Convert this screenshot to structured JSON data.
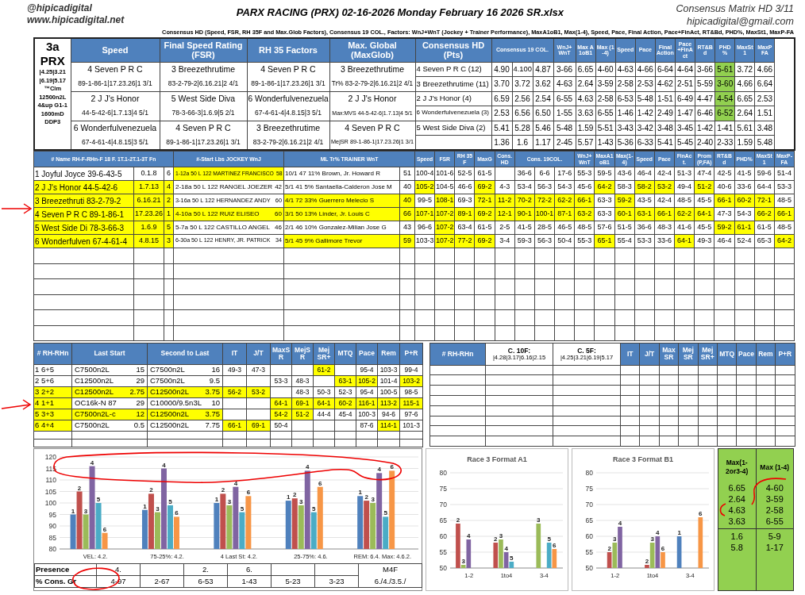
{
  "header": {
    "handle": "@hipicadigital",
    "website": "www.hipicadigital.net",
    "title": "PARX RACING (PRX) 02-16-2026 Monday February 16 2026 SR.xlsx",
    "matrix": "Consensus Matrix HD 3/11",
    "email": "hipicadigital@gmail.com",
    "subtitle": "Consensus HD (Speed, FSR, RH 35F and Max.Glob Factors), Consensus 19 COL., Factors: WnJ+WnT (Jockey + Trainer Performance), MaxA1oB1, Max(1-4), Speed, Pace, Final Action, Pace+FinAct, RT&Bd, PHD%, MaxSt1, MaxP-FA"
  },
  "race_info": [
    "3a",
    "PRX",
    "|4.25|3.21",
    "|6.19|5.17",
    "™Clm",
    "12500n2L",
    "4&up G1-1",
    "1600mD",
    "DDP3"
  ],
  "factor_columns": [
    {
      "title": "Speed",
      "picks": [
        {
          "horse": "4 Seven P R C",
          "line": "89-1-86-1|17.23.26|1  3/1"
        },
        {
          "horse": "2 J J's Honor",
          "line": "44-5-42-6|1.7.13|4  5/1"
        },
        {
          "horse": "6 Wonderfulvenezuela",
          "line": "67-4-61-4|4.8.15|3  5/1"
        }
      ]
    },
    {
      "title": "Final Speed Rating (FSR)",
      "picks": [
        {
          "horse": "3 Breezethrutime",
          "line": "83-2-79-2|6.16.21|2  4/1"
        },
        {
          "horse": "5 West Side Diva",
          "line": "78-3-66-3|1.6.9|5  2/1"
        },
        {
          "horse": "4 Seven P R C",
          "line": "89-1-86-1|17.23.26|1  3/1"
        }
      ]
    },
    {
      "title": "RH 35 Factors",
      "picks": [
        {
          "horse": "4 Seven P R C",
          "line": "89-1-86-1|17.23.26|1  3/1"
        },
        {
          "horse": "6 Wonderfulvenezuela",
          "line": "67-4-61-4|4.8.15|3  5/1"
        },
        {
          "horse": "3 Breezethrutime",
          "line": "83-2-79-2|6.16.21|2  4/1"
        }
      ]
    },
    {
      "title": "Max. Global (MaxGlob)",
      "picks": [
        {
          "horse": "3 Breezethrutime",
          "line": "Tr% 83-2-79-2|6.16.21|2  4/1"
        },
        {
          "horse": "2 J J's Honor",
          "line": "Max:MVS 44-5-42-6|1.7.13|4  5/1"
        },
        {
          "horse": "4 Seven P R C",
          "line": "MejSR 89-1-86-1|17.23.26|1  3/1"
        }
      ]
    }
  ],
  "consensus_hd": {
    "title": "Consensus HD (Pts)",
    "picks": [
      "4 Seven P R C  (12)",
      "3 Breezethrutime  (11)",
      "2 J J's Honor  (4)",
      "6 Wonderfulvenezuela  (3)",
      "5 West Side Diva  (2)"
    ]
  },
  "consensus19_header": "Consensus 19 COL.",
  "stat_headers": [
    "WnJ+ WnT",
    "Max A1oB1",
    "Max (1-4)",
    "Speed",
    "Pace",
    "Final Action",
    "Pace +FinAct",
    "RT&Bd",
    "PHD %",
    "MaxSt1",
    "MaxP FA"
  ],
  "stat_rows": [
    {
      "values": [
        "4.90",
        "4.100",
        "4.87",
        "3-66",
        "6.65",
        "4-60",
        "4-63",
        "4-66",
        "6-64",
        "4-64",
        "3-66",
        "5-61",
        "3.72",
        "4.66"
      ],
      "phd_highlighted": true
    },
    {
      "values": [
        "3.70",
        "3.72",
        "3.62",
        "4-63",
        "2.64",
        "3-59",
        "2-58",
        "2-53",
        "4-62",
        "2-51",
        "5-59",
        "3-60",
        "4.66",
        "6.64"
      ],
      "phd_highlighted": true
    },
    {
      "values": [
        "6.59",
        "2.56",
        "2.54",
        "6-55",
        "4.63",
        "2-58",
        "6-53",
        "5-48",
        "1-51",
        "6-49",
        "4-47",
        "4-54",
        "6.65",
        "2.53"
      ],
      "phd_highlighted": true
    },
    {
      "values": [
        "2.53",
        "6.56",
        "6.50",
        "1-55",
        "3.63",
        "6-55",
        "1-46",
        "1-42",
        "2-49",
        "1-47",
        "6-46",
        "6-52",
        "2.64",
        "1.51"
      ],
      "phd_highlighted": true
    },
    {
      "values": [
        "5.41",
        "5.28",
        "5.46",
        "5-48",
        "1.59",
        "5-51",
        "3-43",
        "3-42",
        "3-48",
        "3-45",
        "1-42",
        "1-41",
        "5.61",
        "3.48"
      ],
      "phd_highlighted": false
    },
    {
      "values": [
        "1.36",
        "1.6",
        "1.17",
        "2-45",
        "5.57",
        "1-43",
        "5-36",
        "6-33",
        "5-41",
        "5-45",
        "2-40",
        "2-33",
        "1.59",
        "5.48"
      ],
      "phd_highlighted": false
    }
  ],
  "entries": {
    "columns": [
      "# Name  RH-F-RHn-F 18 F. 1T.1-2T.1-3T Fn",
      "#-Start  Lbs  JOCKEY  WnJ",
      "ML  Tr%  TRAINER  WnT"
    ],
    "stat_headers": [
      {
        "label": "Speed",
        "kind": "single"
      },
      {
        "label": "FSR",
        "kind": "single"
      },
      {
        "label": "RH 35F",
        "kind": "single"
      },
      {
        "label": "MaxG",
        "kind": "single"
      },
      {
        "label": "Cons.HD",
        "kind": "single"
      },
      {
        "label": "Cons. 19COL.",
        "kind": "triple"
      },
      {
        "label": "WnJ+WnT",
        "kind": "single"
      },
      {
        "label": "MaxA1oB1",
        "kind": "single"
      },
      {
        "label": "Max(1-4)",
        "kind": "single"
      },
      {
        "label": "Speed",
        "kind": "single"
      },
      {
        "label": "Pace",
        "kind": "single"
      },
      {
        "label": "FinAct.",
        "kind": "single"
      },
      {
        "label": "Prom(P,FA)",
        "kind": "single"
      },
      {
        "label": "RT&Bd",
        "kind": "single"
      },
      {
        "label": "PHD%",
        "kind": "single"
      },
      {
        "label": "MaxSt1",
        "kind": "single"
      },
      {
        "label": "MaxP-FA",
        "kind": "single"
      }
    ],
    "rows": [
      {
        "name": "1 Joyful Joyce 39-6-43-5",
        "finishes": "0.1.8",
        "fn": "6",
        "name_highlighted": false,
        "jockey": "1-12a 50 L 122 MARTINEZ FRANCISCO",
        "wnj": "58",
        "jockey_highlighted": true,
        "trainer": "10/1  47 11%  Brown, Jr. Howard R",
        "wnt": "51",
        "trainer_highlighted": false,
        "cells": [
          {
            "value": "100-4",
            "highlighted": false
          },
          {
            "value": "101-6",
            "highlighted": false
          },
          {
            "value": "52-5",
            "highlighted": false
          },
          {
            "value": "61-5",
            "highlighted": false
          },
          {
            "highlighted": false
          },
          {
            "value": "36-6",
            "highlighted": false
          },
          {
            "value": "6-6",
            "highlighted": false
          },
          {
            "value": "17-6",
            "highlighted": false
          },
          {
            "value": "55-3",
            "highlighted": false
          },
          {
            "value": "59-5",
            "highlighted": false
          },
          {
            "value": "43-6",
            "highlighted": false
          },
          {
            "value": "46-4",
            "highlighted": false
          },
          {
            "value": "42-4",
            "highlighted": false
          },
          {
            "value": "51-3",
            "highlighted": false
          },
          {
            "value": "47-4",
            "highlighted": false
          },
          {
            "value": "42-5",
            "highlighted": false
          },
          {
            "value": "41-5",
            "highlighted": false
          },
          {
            "value": "59-6",
            "highlighted": false
          },
          {
            "value": "51-4",
            "highlighted": false
          }
        ]
      },
      {
        "name": "2 J J's Honor  44-5-42-6",
        "finishes": "1.7.13",
        "fn": "4",
        "name_highlighted": true,
        "jockey": "2-18a 50 L 122 RANGEL JOEZER",
        "wnj": "42",
        "jockey_highlighted": false,
        "trainer": "5/1  41  5%  Santaella-Calderon Jose M",
        "wnt": "40",
        "trainer_highlighted": false,
        "cells": [
          {
            "value": "105-2",
            "highlighted": true
          },
          {
            "value": "104-5",
            "highlighted": false
          },
          {
            "value": "46-6",
            "highlighted": false
          },
          {
            "value": "69-2",
            "highlighted": true
          },
          {
            "value": "4-3",
            "highlighted": false
          },
          {
            "value": "53-4",
            "highlighted": false
          },
          {
            "value": "56-3",
            "highlighted": false
          },
          {
            "value": "54-3",
            "highlighted": false
          },
          {
            "value": "45-6",
            "highlighted": false
          },
          {
            "value": "64-2",
            "highlighted": true
          },
          {
            "value": "58-3",
            "highlighted": false
          },
          {
            "value": "58-2",
            "highlighted": true
          },
          {
            "value": "53-2",
            "highlighted": true
          },
          {
            "value": "49-4",
            "highlighted": false
          },
          {
            "value": "51-2",
            "highlighted": true
          },
          {
            "value": "40-6",
            "highlighted": false
          },
          {
            "value": "33-6",
            "highlighted": false
          },
          {
            "value": "64-4",
            "highlighted": false
          },
          {
            "value": "53-3",
            "highlighted": false
          }
        ]
      },
      {
        "name": "3 Breezethruti 83-2-79-2",
        "finishes": "6.16.21",
        "fn": "2",
        "name_highlighted": true,
        "jockey": "3-16a 50 L 122 HERNANDEZ ANDY",
        "wnj": "60",
        "jockey_highlighted": false,
        "trainer": "4/1  72 33%  Guerrero Melecio S",
        "wnt": "40",
        "trainer_highlighted": true,
        "cells": [
          {
            "value": "99-5",
            "highlighted": false
          },
          {
            "value": "108-1",
            "highlighted": true
          },
          {
            "value": "69-3",
            "highlighted": false
          },
          {
            "value": "72-1",
            "highlighted": true
          },
          {
            "value": "11-2",
            "highlighted": true
          },
          {
            "value": "70-2",
            "highlighted": true
          },
          {
            "value": "72-2",
            "highlighted": true
          },
          {
            "value": "62-2",
            "highlighted": true
          },
          {
            "value": "66-1",
            "highlighted": true
          },
          {
            "value": "63-3",
            "highlighted": false
          },
          {
            "value": "59-2",
            "highlighted": true
          },
          {
            "value": "43-5",
            "highlighted": false
          },
          {
            "value": "42-4",
            "highlighted": false
          },
          {
            "value": "48-5",
            "highlighted": false
          },
          {
            "value": "45-5",
            "highlighted": false
          },
          {
            "value": "66-1",
            "highlighted": true
          },
          {
            "value": "60-2",
            "highlighted": true
          },
          {
            "value": "72-1",
            "highlighted": true
          },
          {
            "value": "48-5",
            "highlighted": false
          }
        ]
      },
      {
        "name": "4 Seven P R C  89-1-86-1",
        "finishes": "17.23.26",
        "fn": "1",
        "name_highlighted": true,
        "jockey": "4-10a 50 L 122 RUIZ ELISEO",
        "wnj": "60",
        "jockey_highlighted": true,
        "trainer": "3/1  50 13%  Linder, Jr. Louis C",
        "wnt": "66",
        "trainer_highlighted": true,
        "cells": [
          {
            "value": "107-1",
            "highlighted": true
          },
          {
            "value": "107-2",
            "highlighted": true
          },
          {
            "value": "89-1",
            "highlighted": true
          },
          {
            "value": "69-2",
            "highlighted": true
          },
          {
            "value": "12-1",
            "highlighted": true
          },
          {
            "value": "90-1",
            "highlighted": true
          },
          {
            "value": "100-1",
            "highlighted": true
          },
          {
            "value": "87-1",
            "highlighted": true
          },
          {
            "value": "63-2",
            "highlighted": true
          },
          {
            "value": "63-3",
            "highlighted": false
          },
          {
            "value": "60-1",
            "highlighted": true
          },
          {
            "value": "63-1",
            "highlighted": true
          },
          {
            "value": "66-1",
            "highlighted": true
          },
          {
            "value": "62-2",
            "highlighted": true
          },
          {
            "value": "64-1",
            "highlighted": true
          },
          {
            "value": "47-3",
            "highlighted": false
          },
          {
            "value": "54-3",
            "highlighted": false
          },
          {
            "value": "66-2",
            "highlighted": true
          },
          {
            "value": "66-1",
            "highlighted": true
          }
        ]
      },
      {
        "name": "5 West Side Di 78-3-66-3",
        "finishes": "1.6.9",
        "fn": "5",
        "name_highlighted": true,
        "jockey": "5-7a 50 L 122 CASTILLO ANGEL",
        "wnj": "46",
        "jockey_highlighted": false,
        "trainer": "2/1  46 10%  Gonzalez-Milian Jose G",
        "wnt": "43",
        "trainer_highlighted": false,
        "cells": [
          {
            "value": "96-6",
            "highlighted": false
          },
          {
            "value": "107-2",
            "highlighted": true
          },
          {
            "value": "63-4",
            "highlighted": false
          },
          {
            "value": "61-5",
            "highlighted": false
          },
          {
            "value": "2-5",
            "highlighted": false
          },
          {
            "value": "41-5",
            "highlighted": false
          },
          {
            "value": "28-5",
            "highlighted": false
          },
          {
            "value": "46-5",
            "highlighted": false
          },
          {
            "value": "48-5",
            "highlighted": false
          },
          {
            "value": "57-6",
            "highlighted": false
          },
          {
            "value": "51-5",
            "highlighted": false
          },
          {
            "value": "36-6",
            "highlighted": false
          },
          {
            "value": "48-3",
            "highlighted": false
          },
          {
            "value": "41-6",
            "highlighted": false
          },
          {
            "value": "45-5",
            "highlighted": false
          },
          {
            "value": "59-2",
            "highlighted": true
          },
          {
            "value": "61-1",
            "highlighted": true
          },
          {
            "value": "61-5",
            "highlighted": false
          },
          {
            "value": "48-5",
            "highlighted": false
          }
        ]
      },
      {
        "name": "6 Wonderfulven 67-4-61-4",
        "finishes": "4.8.15",
        "fn": "3",
        "name_highlighted": true,
        "jockey": "6-30a 50 L 122 HENRY, JR. PATRICK",
        "wnj": "34",
        "jockey_highlighted": false,
        "trainer": "5/1  45  9%  Gallimore Trevor",
        "wnt": "59",
        "trainer_highlighted": true,
        "cells": [
          {
            "value": "103-3",
            "highlighted": false
          },
          {
            "value": "107-2",
            "highlighted": true
          },
          {
            "value": "77-2",
            "highlighted": true
          },
          {
            "value": "69-2",
            "highlighted": true
          },
          {
            "value": "3-4",
            "highlighted": false
          },
          {
            "value": "59-3",
            "highlighted": false
          },
          {
            "value": "56-3",
            "highlighted": false
          },
          {
            "value": "50-4",
            "highlighted": false
          },
          {
            "value": "55-3",
            "highlighted": false
          },
          {
            "value": "65-1",
            "highlighted": true
          },
          {
            "value": "55-4",
            "highlighted": false
          },
          {
            "value": "53-3",
            "highlighted": false
          },
          {
            "value": "33-6",
            "highlighted": false
          },
          {
            "value": "64-1",
            "highlighted": true
          },
          {
            "value": "49-3",
            "highlighted": false
          },
          {
            "value": "46-4",
            "highlighted": false
          },
          {
            "value": "52-4",
            "highlighted": false
          },
          {
            "value": "65-3",
            "highlighted": false
          },
          {
            "value": "64-2",
            "highlighted": true
          }
        ]
      }
    ]
  },
  "past": {
    "columns": [
      "# RH-RHn",
      "Last Start",
      "Second to Last",
      "IT",
      "J/T",
      "MaxS R",
      "MejS R",
      "Mej SR+",
      "MTQ",
      "Pace",
      "Rem",
      "P+R"
    ],
    "rows": [
      {
        "horse": {
          "value": "1  6+5",
          "highlighted": false
        },
        "last_start": {
          "race": "C7500n2L",
          "value": "15",
          "highlighted": false
        },
        "second_last": {
          "race": "C7500n2L",
          "value": "16",
          "highlighted": false
        },
        "figures": [
          {
            "value": "49-3",
            "highlighted": false
          },
          {
            "value": "47-3",
            "highlighted": false
          },
          {
            "highlighted": false
          },
          {
            "highlighted": false
          },
          {
            "value": "61-2",
            "highlighted": true
          },
          {
            "highlighted": false
          },
          {
            "value": "95-4",
            "highlighted": false
          },
          {
            "value": "103-3",
            "highlighted": false
          },
          {
            "value": "99-4",
            "highlighted": false
          }
        ]
      },
      {
        "horse": {
          "value": "2  5+6",
          "highlighted": false
        },
        "last_start": {
          "race": "C12500n2L",
          "value": "29",
          "highlighted": false
        },
        "second_last": {
          "race": "C7500n2L",
          "value": "9.5",
          "highlighted": false
        },
        "figures": [
          {
            "highlighted": false
          },
          {
            "highlighted": false
          },
          {
            "value": "53-3",
            "highlighted": false
          },
          {
            "value": "48-3",
            "highlighted": false
          },
          {
            "highlighted": false
          },
          {
            "value": "63-1",
            "highlighted": true
          },
          {
            "value": "105-2",
            "highlighted": true
          },
          {
            "value": "101-4",
            "highlighted": false
          },
          {
            "value": "103-2",
            "highlighted": true
          }
        ]
      },
      {
        "horse": {
          "value": "3  2+2",
          "highlighted": true
        },
        "last_start": {
          "race": "C12500n2L",
          "value": "2.75",
          "highlighted": true
        },
        "second_last": {
          "race": "C12500n2L",
          "value": "3.75",
          "highlighted": true
        },
        "figures": [
          {
            "value": "56-2",
            "highlighted": true
          },
          {
            "value": "53-2",
            "highlighted": true
          },
          {
            "highlighted": false
          },
          {
            "value": "48-3",
            "highlighted": false
          },
          {
            "value": "50-3",
            "highlighted": false
          },
          {
            "value": "52-3",
            "highlighted": false
          },
          {
            "value": "95-4",
            "highlighted": false
          },
          {
            "value": "100-5",
            "highlighted": false
          },
          {
            "value": "98-5",
            "highlighted": false
          }
        ]
      },
      {
        "horse": {
          "value": "4  1+1",
          "highlighted": true
        },
        "last_start": {
          "race": "OC16k-N 87",
          "value": "29",
          "highlighted": false
        },
        "second_last": {
          "race": "C10000/9.5n3L",
          "value": "10",
          "highlighted": false
        },
        "figures": [
          {
            "highlighted": false
          },
          {
            "highlighted": false
          },
          {
            "value": "64-1",
            "highlighted": true
          },
          {
            "value": "69-1",
            "highlighted": true
          },
          {
            "value": "64-1",
            "highlighted": true
          },
          {
            "value": "60-2",
            "highlighted": true
          },
          {
            "value": "116-1",
            "highlighted": true
          },
          {
            "value": "113-2",
            "highlighted": true
          },
          {
            "value": "115-1",
            "highlighted": true
          }
        ]
      },
      {
        "horse": {
          "value": "5  3+3",
          "highlighted": true
        },
        "last_start": {
          "race": "C7500n2L-c",
          "value": "12",
          "highlighted": true
        },
        "second_last": {
          "race": "C12500n2L",
          "value": "3.75",
          "highlighted": true
        },
        "figures": [
          {
            "highlighted": false
          },
          {
            "highlighted": false
          },
          {
            "value": "54-2",
            "highlighted": true
          },
          {
            "value": "51-2",
            "highlighted": true
          },
          {
            "value": "44-4",
            "highlighted": false
          },
          {
            "value": "45-4",
            "highlighted": false
          },
          {
            "value": "100-3",
            "highlighted": false
          },
          {
            "value": "94-6",
            "highlighted": false
          },
          {
            "value": "97-6",
            "highlighted": false
          }
        ]
      },
      {
        "horse": {
          "value": "6  4+4",
          "highlighted": true
        },
        "last_start": {
          "race": "C7500n2L",
          "value": "0.5",
          "highlighted": false
        },
        "second_last": {
          "race": "C12500n2L",
          "value": "7.75",
          "highlighted": false
        },
        "figures": [
          {
            "value": "66-1",
            "highlighted": true
          },
          {
            "value": "69-1",
            "highlighted": true
          },
          {
            "value": "50-4",
            "highlighted": false
          },
          {
            "highlighted": false
          },
          {
            "highlighted": false
          },
          {
            "highlighted": false
          },
          {
            "value": "87-6",
            "highlighted": false
          },
          {
            "value": "114-1",
            "highlighted": true
          },
          {
            "value": "101-3",
            "highlighted": false
          }
        ]
      }
    ]
  },
  "analysis": {
    "columns": [
      {
        "label": "# RH-RHn"
      },
      {
        "label": "C. 10F:",
        "detail": "|4.28|3.17|6.16|2.15"
      },
      {
        "label": "C. 5F:",
        "detail": "|4.25|3.21|6.19|5.17"
      },
      {
        "label": "IT"
      },
      {
        "label": "J/T"
      },
      {
        "label": "Max SR"
      },
      {
        "label": "Mej SR"
      },
      {
        "label": "Mej SR+"
      },
      {
        "label": "MTQ"
      },
      {
        "label": "Pace"
      },
      {
        "label": "Rem"
      },
      {
        "label": "P+R"
      }
    ]
  },
  "speed_chart": {
    "chart_data": {
      "type": "bar",
      "grid": true,
      "categories": [
        "VEL: 4.2.",
        "75-25%: 4.2.",
        "4 Last St: 4.2.",
        "25-75%: 4.6.",
        "REM: 6.4. Max: 4.6.2."
      ],
      "ylim": [
        80,
        120
      ],
      "yticks": [
        80,
        85,
        90,
        95,
        100,
        105,
        110,
        115,
        120
      ],
      "series": [
        {
          "name": "1",
          "color": "#4f81bd",
          "values": [
            95,
            97,
            100,
            101,
            103
          ]
        },
        {
          "name": "2",
          "color": "#c0504d",
          "values": [
            105,
            104,
            104,
            102,
            101
          ]
        },
        {
          "name": "3",
          "color": "#9bbb59",
          "values": [
            95,
            96,
            99,
            99,
            100
          ]
        },
        {
          "name": "4",
          "color": "#8064a2",
          "values": [
            116,
            115,
            107,
            114,
            113
          ]
        },
        {
          "name": "5",
          "color": "#4bacc6",
          "values": [
            100,
            99,
            96,
            96,
            94
          ]
        },
        {
          "name": "6",
          "color": "#f79646",
          "values": [
            87,
            94,
            103,
            107,
            114
          ]
        }
      ]
    }
  },
  "summary": {
    "presence_label": "Presence",
    "share_label": "% Cons. Gr",
    "groups": [
      {
        "presence": "4.",
        "share": "4-97"
      },
      {
        "share": "2-67"
      },
      {
        "presence": "2.",
        "share": "6-53"
      },
      {
        "presence": "6.",
        "share": "1-43"
      },
      {
        "share": "5-23"
      },
      {
        "share": "3-23"
      }
    ],
    "m4f_label": "M4F",
    "m4f_value": "6./4./3.5./"
  },
  "format_charts": [
    {
      "chart_data": {
        "type": "bar",
        "grid": true,
        "title": "Race 3 Format A1",
        "categories": [
          "1-2",
          "1to4",
          "3-4"
        ],
        "ylim": [
          50,
          80
        ],
        "yticks": [
          50,
          55,
          60,
          65,
          70,
          75,
          80
        ],
        "series": [
          {
            "name": "2",
            "color": "#c0504d",
            "values": [
              64,
              58,
              null
            ]
          },
          {
            "name": "3",
            "color": "#9bbb59",
            "values": [
              51,
              59,
              64
            ]
          },
          {
            "name": "4",
            "color": "#8064a2",
            "values": [
              59,
              55,
              null
            ]
          },
          {
            "name": "5",
            "color": "#4bacc6",
            "values": [
              null,
              52,
              58
            ]
          },
          {
            "name": "6",
            "color": "#f79646",
            "values": [
              null,
              null,
              56
            ]
          }
        ]
      }
    },
    {
      "chart_data": {
        "type": "bar",
        "grid": true,
        "title": "Race 3 Format B1",
        "categories": [
          "1-2",
          "1to4",
          "3-4"
        ],
        "ylim": [
          50,
          80
        ],
        "yticks": [
          50,
          55,
          60,
          65,
          70,
          75,
          80
        ],
        "series": [
          {
            "name": "1",
            "color": "#4f81bd",
            "values": [
              null,
              null,
              60
            ]
          },
          {
            "name": "2",
            "color": "#c0504d",
            "values": [
              55,
              51,
              null
            ]
          },
          {
            "name": "3",
            "color": "#9bbb59",
            "values": [
              58,
              58,
              null
            ]
          },
          {
            "name": "4",
            "color": "#8064a2",
            "values": [
              63,
              60,
              null
            ]
          },
          {
            "name": "6",
            "color": "#f79646",
            "values": [
              null,
              55,
              66
            ]
          }
        ]
      }
    }
  ],
  "max_box": {
    "columns": [
      {
        "title": "Max(1-2or3-4)",
        "values": [
          "6.65",
          "2.64",
          "4.63",
          "3.63",
          "1.6",
          "5.8"
        ]
      },
      {
        "title": "Max (1-4)",
        "values": [
          "4-60",
          "3-59",
          "2-58",
          "6-55",
          "5-9",
          "1-17"
        ]
      }
    ]
  }
}
